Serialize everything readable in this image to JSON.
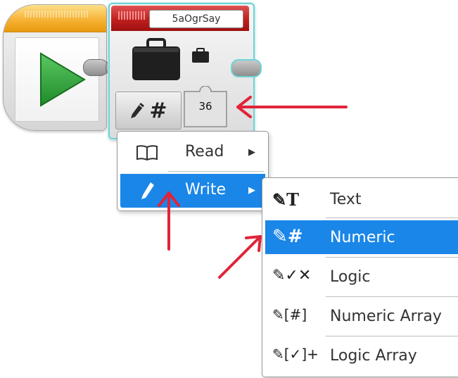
{
  "start_block": {
    "play_icon": "play-icon"
  },
  "file_block": {
    "file_name": "5aOgrSay",
    "value": "36",
    "mode_icons": [
      "pencil-icon",
      "hash-icon"
    ]
  },
  "menu1": {
    "items": [
      {
        "label": "Read",
        "icon": "book-icon",
        "has_submenu": true,
        "selected": false
      },
      {
        "label": "Write",
        "icon": "pencil-icon",
        "has_submenu": true,
        "selected": true
      }
    ]
  },
  "menu2": {
    "items": [
      {
        "label": "Text",
        "icon": "pencil-text-icon",
        "selected": false
      },
      {
        "label": "Numeric",
        "icon": "pencil-hash-icon",
        "selected": true
      },
      {
        "label": "Logic",
        "icon": "pencil-logic-icon",
        "selected": false
      },
      {
        "label": "Numeric Array",
        "icon": "pencil-numeric-array-icon",
        "selected": false
      },
      {
        "label": "Logic Array",
        "icon": "pencil-logic-array-icon",
        "selected": false
      }
    ]
  },
  "colors": {
    "selection": "#1a86e8",
    "annotation_arrow": "#e0243a",
    "block_outline": "#6fd4d7",
    "file_header": "#c0201f",
    "start_header": "#f6b02f",
    "play_green": "#2fa53a"
  }
}
